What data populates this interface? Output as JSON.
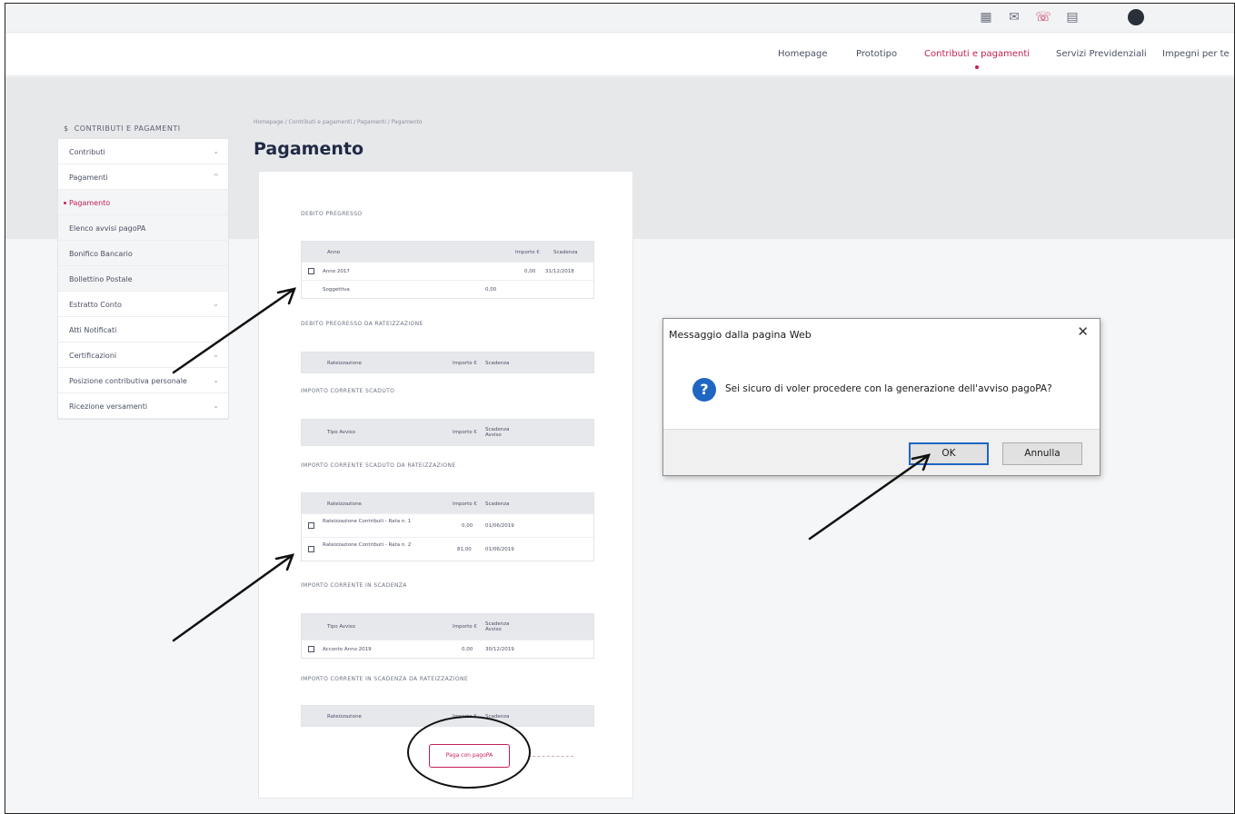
{
  "nav": {
    "items": [
      "Homepage",
      "Prototipo",
      "Contributi e pagamenti",
      "Servizi Previdenziali",
      "Impegni per te"
    ],
    "active_index": 2
  },
  "sidebar": {
    "heading": "CONTRIBUTI E PAGAMENTI",
    "items": [
      {
        "label": "Contributi",
        "chevron": "⌄"
      },
      {
        "label": "Pagamenti",
        "chevron": "^"
      },
      {
        "label": "Pagamento",
        "chevron": ""
      },
      {
        "label": "Elenco avvisi pagoPA",
        "chevron": ""
      },
      {
        "label": "Bonifico Bancario",
        "chevron": ""
      },
      {
        "label": "Bollettino Postale",
        "chevron": ""
      },
      {
        "label": "Estratto Conto",
        "chevron": "⌄"
      },
      {
        "label": "Atti Notificati",
        "chevron": ""
      },
      {
        "label": "Certificazioni",
        "chevron": "⌄"
      },
      {
        "label": "Posizione contributiva personale",
        "chevron": "⌄"
      },
      {
        "label": "Ricezione versamenti",
        "chevron": "⌄"
      }
    ]
  },
  "main": {
    "breadcrumb": "Homepage / Contributi e pagamenti / Pagamenti / Pagamento",
    "title": "Pagamento",
    "sections": [
      "DEBITO PREGRESSO",
      "DEBITO PREGRESSO DA RATEIZZAZIONE",
      "IMPORTO CORRENTE SCADUTO",
      "IMPORTO CORRENTE SCADUTO DA RATEIZZAZIONE",
      "IMPORTO CORRENTE IN SCADENZA",
      "IMPORTO CORRENTE IN SCADENZA DA RATEIZZAZIONE"
    ],
    "t1": {
      "headers": [
        "Anno",
        "Importo €",
        "Scadenza"
      ],
      "rows": [
        {
          "label": "Anno 2017",
          "amount": "0,00",
          "date": "31/12/2018"
        },
        {
          "label": "Soggettiva",
          "amount": "0,00",
          "date": ""
        }
      ]
    },
    "t2": {
      "headers": [
        "Rateizzazione",
        "Importo €",
        "Scadenza"
      ]
    },
    "t3": {
      "headers": [
        "Tipo Avviso",
        "Importo €",
        "Scadenza Avviso"
      ]
    },
    "t4": {
      "headers": [
        "Rateizzazione",
        "Importo €",
        "Scadenza"
      ],
      "rows": [
        {
          "label": "Rateizzazione Contributi - Rata n. 1",
          "amount": "0,00",
          "date": "01/06/2019"
        },
        {
          "label": "Rateizzazione Contributi - Rata n. 2",
          "amount": "81,00",
          "date": "01/06/2019"
        }
      ]
    },
    "t5": {
      "headers": [
        "Tipo Avviso",
        "Importo €",
        "Scadenza Avviso"
      ],
      "rows": [
        {
          "label": "Acconto Anno 2019",
          "amount": "0,00",
          "date": "30/12/2019"
        }
      ]
    },
    "t6": {
      "headers": [
        "Rateizzazione",
        "Importo €",
        "Scadenza"
      ]
    },
    "pay_button": "Paga con pagoPA"
  },
  "dialog": {
    "title": "Messaggio dalla pagina Web",
    "message": "Sei sicuro di voler procedere con la generazione dell'avviso pagoPA?",
    "ok": "OK",
    "cancel": "Annulla",
    "accent": "#1f66c2"
  },
  "colors": {
    "brand": "#c21f4f",
    "title": "#1f2a44"
  }
}
